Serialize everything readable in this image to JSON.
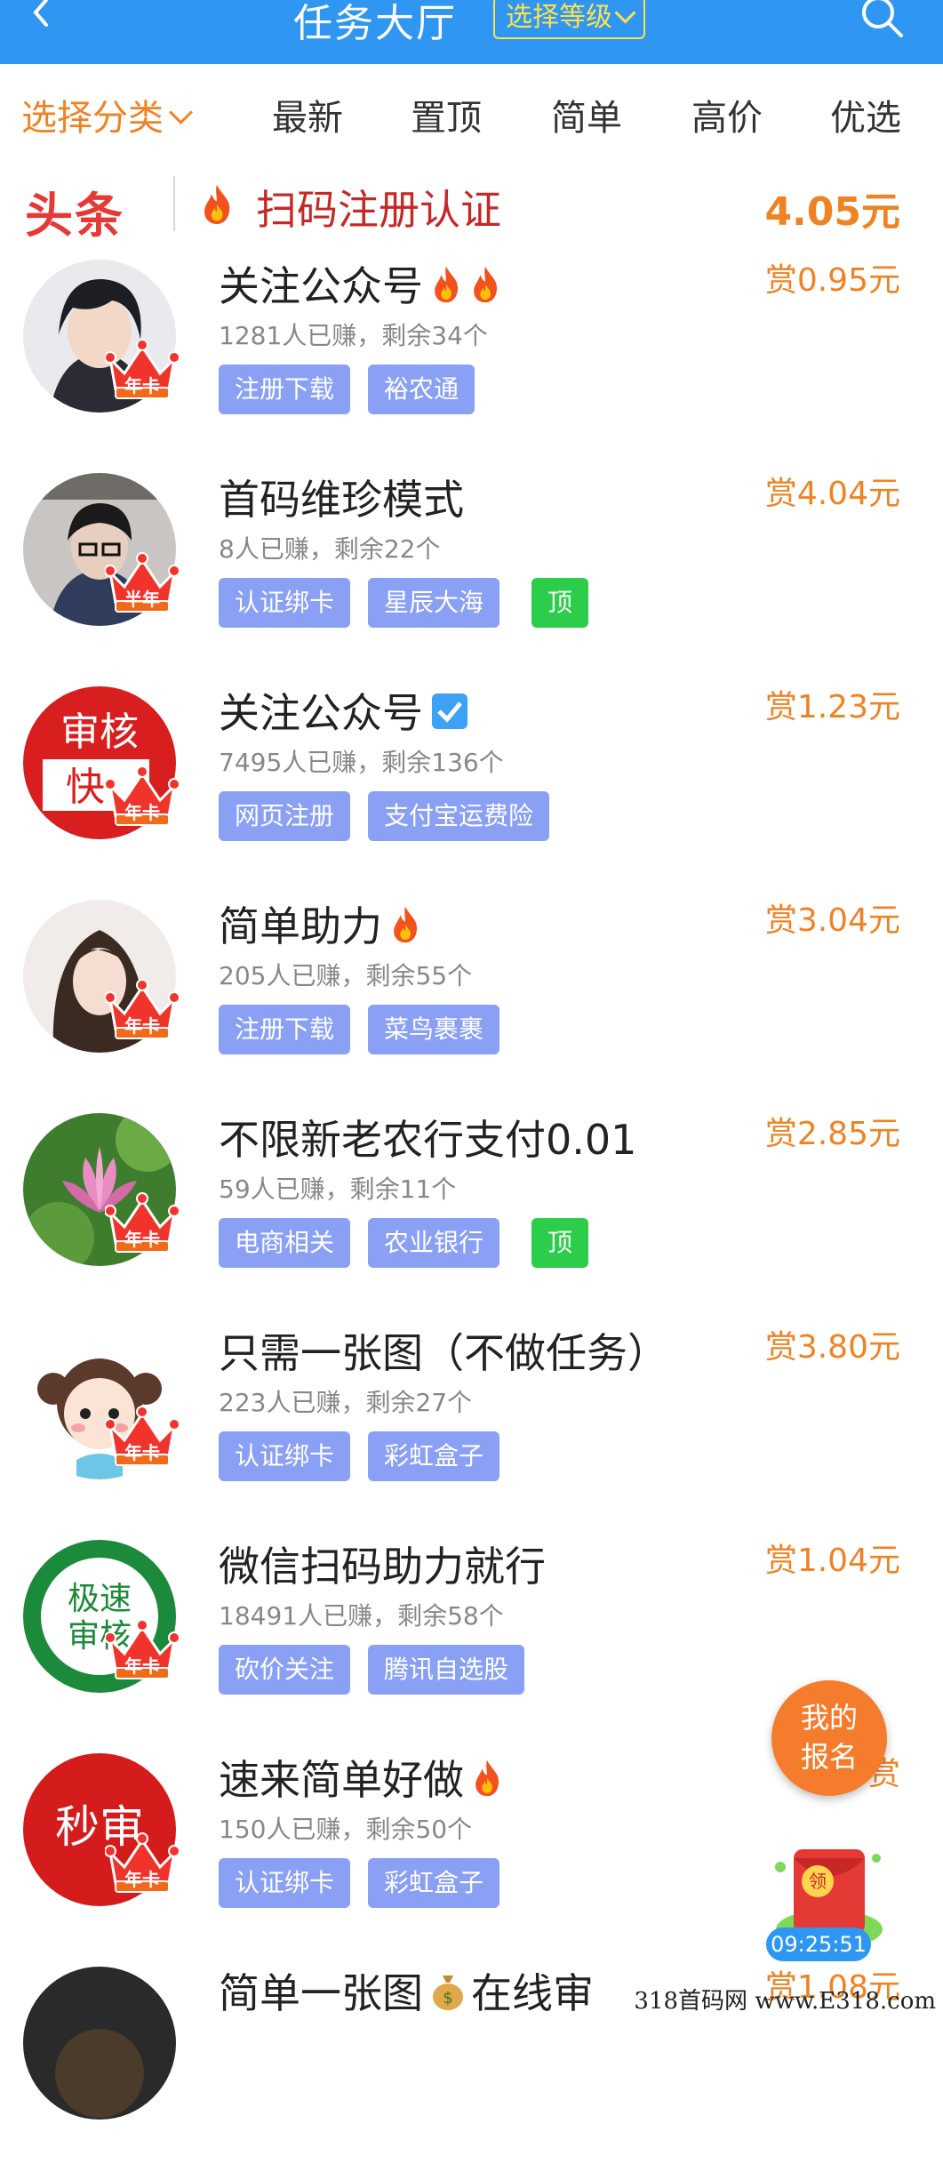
{
  "header": {
    "title": "任务大厅",
    "level_button": "选择等级"
  },
  "tabs": [
    {
      "label": "选择分类"
    },
    {
      "label": "最新"
    },
    {
      "label": "置顶"
    },
    {
      "label": "简单"
    },
    {
      "label": "高价"
    },
    {
      "label": "优选"
    }
  ],
  "headline": {
    "logo": "头条",
    "text": "扫码注册认证",
    "price": "4.05元"
  },
  "tasks": [
    {
      "title": "关注公众号",
      "emojis": [
        "fire-icon",
        "fire-icon"
      ],
      "meta": "1281人已赚，剩余34个",
      "tags": [
        "注册下载",
        "裕农通"
      ],
      "top": false,
      "reward": "赏0.95元",
      "badge": "年卡",
      "avatar": "anime-boy"
    },
    {
      "title": "首码维珍模式",
      "emojis": [],
      "meta": "8人已赚，剩余22个",
      "tags": [
        "认证绑卡",
        "星辰大海"
      ],
      "top": true,
      "top_label": "顶",
      "reward": "赏4.04元",
      "badge": "半年",
      "avatar": "boy-photo"
    },
    {
      "title": "关注公众号",
      "emojis": [
        "check-icon"
      ],
      "meta": "7495人已赚，剩余136个",
      "tags": [
        "网页注册",
        "支付宝运费险"
      ],
      "top": false,
      "reward": "赏1.23元",
      "badge": "年卡",
      "avatar": "shenhe-kuai",
      "avatar_text": [
        "审核",
        "快"
      ]
    },
    {
      "title": "简单助力",
      "emojis": [
        "fire-icon"
      ],
      "meta": "205人已赚，剩余55个",
      "tags": [
        "注册下载",
        "菜鸟裹裹"
      ],
      "top": false,
      "reward": "赏3.04元",
      "badge": "年卡",
      "avatar": "girl-photo"
    },
    {
      "title": "不限新老农行支付0.01",
      "emojis": [],
      "meta": "59人已赚，剩余11个",
      "tags": [
        "电商相关",
        "农业银行"
      ],
      "top": true,
      "top_label": "顶",
      "reward": "赏2.85元",
      "badge": "年卡",
      "avatar": "lotus"
    },
    {
      "title": "只需一张图（不做任务）",
      "emojis": [],
      "meta": "223人已赚，剩余27个",
      "tags": [
        "认证绑卡",
        "彩虹盒子"
      ],
      "top": false,
      "reward": "赏3.80元",
      "badge": "年卡",
      "avatar": "cartoon-girl"
    },
    {
      "title": "微信扫码助力就行",
      "emojis": [],
      "meta": "18491人已赚，剩余58个",
      "tags": [
        "砍价关注",
        "腾讯自选股"
      ],
      "top": false,
      "reward": "赏1.04元",
      "badge": "年卡",
      "avatar": "jisu-shenhe",
      "avatar_text": [
        "极速",
        "审核"
      ]
    },
    {
      "title": "速来简单好做",
      "emojis": [
        "fire-icon"
      ],
      "meta": "150人已赚，剩余50个",
      "tags": [
        "认证绑卡",
        "彩虹盒子"
      ],
      "top": false,
      "reward": "赏",
      "badge": "年卡",
      "avatar": "miaoshen",
      "avatar_text": [
        "秒审"
      ]
    },
    {
      "title": "简单一张图",
      "title_suffix": "在线审",
      "emojis": [
        "money-bag-icon"
      ],
      "meta": "",
      "tags": [],
      "top": false,
      "reward": "赏1.08元",
      "badge": "",
      "avatar": "dark"
    }
  ],
  "floating": {
    "my_signup": [
      "我的",
      "报名"
    ],
    "redpack_label": "领",
    "timer": "09:25:51"
  },
  "watermark": "318首码网 www.E318.com",
  "colors": {
    "header": "#2f97f2",
    "accent": "#ef8324",
    "tag": "#8aa0f4",
    "top_tag": "#2ccd4a",
    "headline_red": "#c62828"
  }
}
